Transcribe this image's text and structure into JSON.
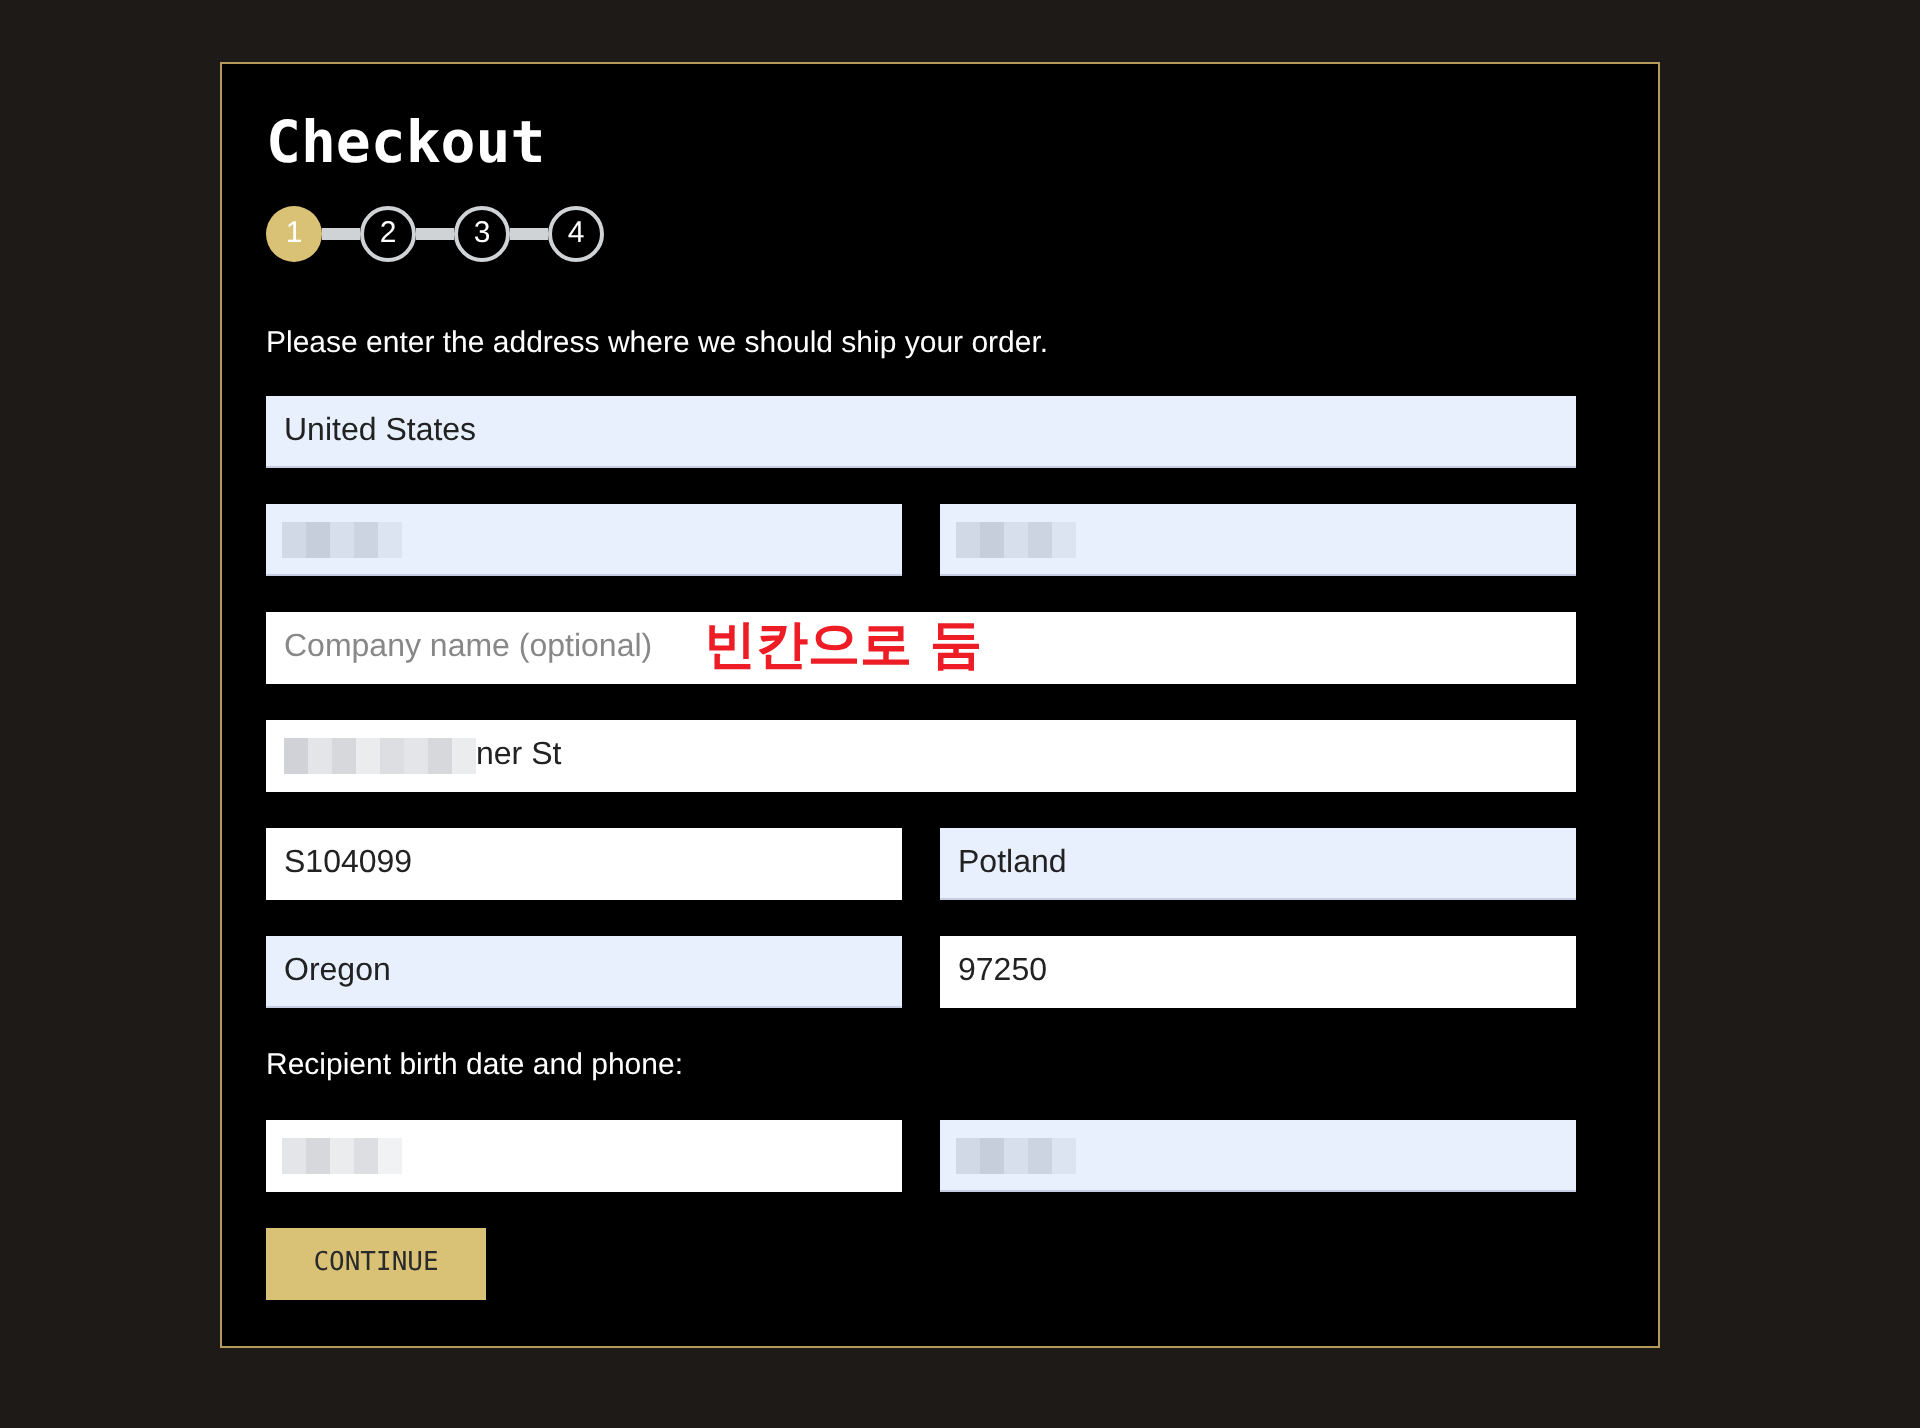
{
  "title": "Checkout",
  "steps": [
    {
      "label": "1",
      "selected": true
    },
    {
      "label": "2",
      "selected": false
    },
    {
      "label": "3",
      "selected": false
    },
    {
      "label": "4",
      "selected": false
    }
  ],
  "intro": "Please enter the address where we should ship your order.",
  "address_rows": [
    [
      {
        "kind": "value",
        "value": "United States",
        "autofilled": true
      }
    ],
    [
      {
        "kind": "redacted",
        "autofilled": true
      },
      {
        "kind": "redacted",
        "autofilled": true
      }
    ],
    [
      {
        "kind": "placeholder",
        "placeholder": "Company name (optional)",
        "autofilled": false,
        "annotation": "빈칸으로 둠"
      }
    ],
    [
      {
        "kind": "partly_redacted",
        "value": "ner St",
        "autofilled": false
      }
    ],
    [
      {
        "kind": "value",
        "value": "S104099",
        "autofilled": false
      },
      {
        "kind": "value",
        "value": "Potland",
        "autofilled": true
      }
    ],
    [
      {
        "kind": "value",
        "value": "Oregon",
        "autofilled": true
      },
      {
        "kind": "value",
        "value": "97250",
        "autofilled": false
      }
    ]
  ],
  "recipient_label": "Recipient birth date and phone:",
  "recipient_row": [
    {
      "kind": "redacted",
      "autofilled": false
    },
    {
      "kind": "redacted",
      "autofilled": true
    }
  ],
  "button": "CONTINUE"
}
